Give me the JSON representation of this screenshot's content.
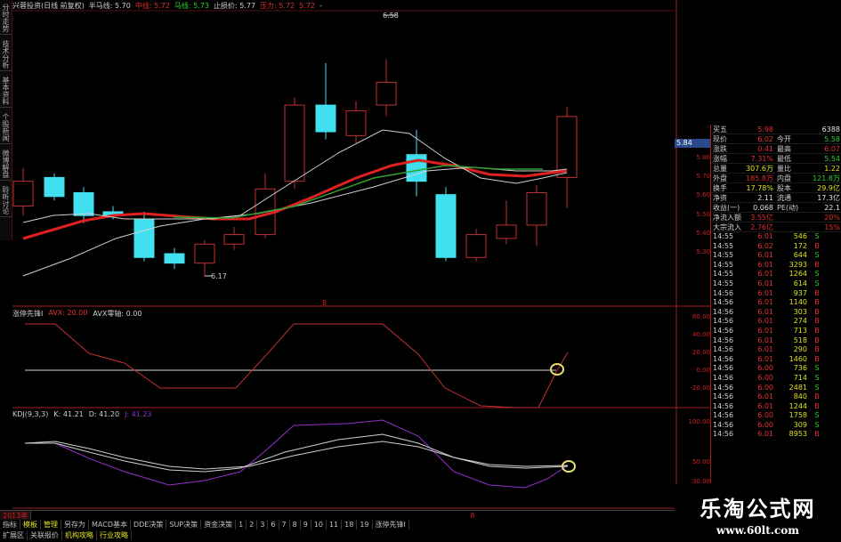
{
  "header": {
    "stock": "兴蓉投资(日线 前复权)",
    "half_ma": "半马线: 5.70",
    "mid_ma": "中线: 5.72",
    "ma": "马线: 5.73",
    "stop": "止损价: 5.77",
    "pressure": "压力: 5.72",
    "pressure2": "5.72",
    "dash": "-"
  },
  "left_tabs": [
    "分时走势",
    "技术分析",
    "基本资料",
    "个股新闻",
    "微博解盘",
    "聆听讨论"
  ],
  "main_axis": {
    "ticks": [
      "5.80",
      "5.70",
      "5.60",
      "5.50",
      "5.40",
      "5.30"
    ],
    "current": "5.84"
  },
  "candles_annot": {
    "high": "6.58",
    "low": "6.17"
  },
  "ind1": {
    "title": "涨停先锋I",
    "avx": "AVX: 20.00",
    "avxzero": "AVX零轴: 0.00",
    "marker": "8",
    "ticks": [
      "60.00",
      "40.00",
      "20.00",
      "0.00",
      "-20.00"
    ]
  },
  "ind2": {
    "title": "KDJ(9,3,3)",
    "k": "K: 41.21",
    "d": "D: 41.20",
    "j": "J: 41.23",
    "ticks": [
      "100.00",
      "50.00",
      "30.00"
    ]
  },
  "quote": {
    "rows": [
      {
        "l1": "买五",
        "v1": "5.98",
        "l2": "",
        "v2": "6388",
        "c1": "#e03030",
        "c2": "#e0e0e0"
      },
      {
        "l1": "现价",
        "v1": "6.02",
        "l2": "今开",
        "v2": "5.58",
        "c1": "#e03030",
        "c2": "#30d030"
      },
      {
        "l1": "涨跌",
        "v1": "0.41",
        "l2": "最高",
        "v2": "6.07",
        "c1": "#e03030",
        "c2": "#e03030"
      },
      {
        "l1": "涨幅",
        "v1": "7.31%",
        "l2": "最低",
        "v2": "5.54",
        "c1": "#e03030",
        "c2": "#30d030"
      },
      {
        "l1": "总量",
        "v1": "307.6万",
        "l2": "量比",
        "v2": "1.22",
        "c1": "#e0e020",
        "c2": "#e0e020"
      },
      {
        "l1": "外盘",
        "v1": "185.8万",
        "l2": "内盘",
        "v2": "121.8万",
        "c1": "#e03030",
        "c2": "#30d030"
      },
      {
        "l1": "换手",
        "v1": "17.78%",
        "l2": "股本",
        "v2": "29.9亿",
        "c1": "#e0e020",
        "c2": "#e0e020"
      },
      {
        "l1": "净资",
        "v1": "2.11",
        "l2": "流通",
        "v2": "17.3亿",
        "c1": "#e0e0e0",
        "c2": "#e0e0e0"
      },
      {
        "l1": "收益(一)",
        "v1": "0.068",
        "l2": "PE(动)",
        "v2": "22.1",
        "c1": "#e0e0e0",
        "c2": "#e0e0e0"
      },
      {
        "l1": "净流入额",
        "v1": "3.55亿",
        "l2": "",
        "v2": "20%",
        "c1": "#e03030",
        "c2": "#e03030"
      },
      {
        "l1": "大宗流入",
        "v1": "2.76亿",
        "l2": "",
        "v2": "15%",
        "c1": "#e03030",
        "c2": "#e03030"
      }
    ]
  },
  "ticks": [
    {
      "t": "14:55",
      "p": "6.01",
      "v": "546",
      "s": "S"
    },
    {
      "t": "14:55",
      "p": "6.02",
      "v": "172",
      "s": "B"
    },
    {
      "t": "14:55",
      "p": "6.01",
      "v": "644",
      "s": "S"
    },
    {
      "t": "14:55",
      "p": "6.01",
      "v": "3293",
      "s": "B"
    },
    {
      "t": "14:55",
      "p": "6.01",
      "v": "1264",
      "s": "S"
    },
    {
      "t": "14:55",
      "p": "6.01",
      "v": "614",
      "s": "S"
    },
    {
      "t": "14:56",
      "p": "6.01",
      "v": "937",
      "s": "B"
    },
    {
      "t": "14:56",
      "p": "6.01",
      "v": "1140",
      "s": "B"
    },
    {
      "t": "14:56",
      "p": "6.01",
      "v": "303",
      "s": "B"
    },
    {
      "t": "14:56",
      "p": "6.01",
      "v": "274",
      "s": "B"
    },
    {
      "t": "14:56",
      "p": "6.01",
      "v": "713",
      "s": "B"
    },
    {
      "t": "14:56",
      "p": "6.01",
      "v": "518",
      "s": "B"
    },
    {
      "t": "14:56",
      "p": "6.01",
      "v": "290",
      "s": "B"
    },
    {
      "t": "14:56",
      "p": "6.01",
      "v": "1460",
      "s": "B"
    },
    {
      "t": "14:56",
      "p": "6.00",
      "v": "736",
      "s": "S"
    },
    {
      "t": "14:56",
      "p": "6.00",
      "v": "714",
      "s": "S"
    },
    {
      "t": "14:56",
      "p": "6.00",
      "v": "2481",
      "s": "S"
    },
    {
      "t": "14:56",
      "p": "6.01",
      "v": "840",
      "s": "B"
    },
    {
      "t": "14:56",
      "p": "6.01",
      "v": "1244",
      "s": "B"
    },
    {
      "t": "14:56",
      "p": "6.00",
      "v": "1758",
      "s": "S"
    },
    {
      "t": "14:56",
      "p": "6.00",
      "v": "309",
      "s": "S"
    },
    {
      "t": "14:56",
      "p": "6.01",
      "v": "8953",
      "s": "B"
    }
  ],
  "bottom": {
    "year": "2013年",
    "marker": "8",
    "row1": [
      "指标",
      "模板",
      "管理",
      "另存为",
      "MACD基本",
      "DDE决策",
      "SUP决策",
      "资金决策",
      "1",
      "2",
      "3",
      "6",
      "7",
      "8",
      "9",
      "10",
      "11",
      "18",
      "19",
      "涨停先锋I"
    ],
    "row2": [
      "扩展区",
      "关联报价",
      "机构攻略",
      "行业攻略"
    ]
  },
  "watermark": {
    "line1": "乐淘公式网",
    "line2": "www.60lt.com"
  },
  "colors": {
    "up": "#c03030",
    "down": "#40e0f0",
    "bull": "#e03030",
    "bear": "#30d030",
    "ma_red": "#e02020",
    "ma_green": "#30a030",
    "ma_white": "#d0d0d0",
    "kdj_purple": "#9030d0"
  }
}
